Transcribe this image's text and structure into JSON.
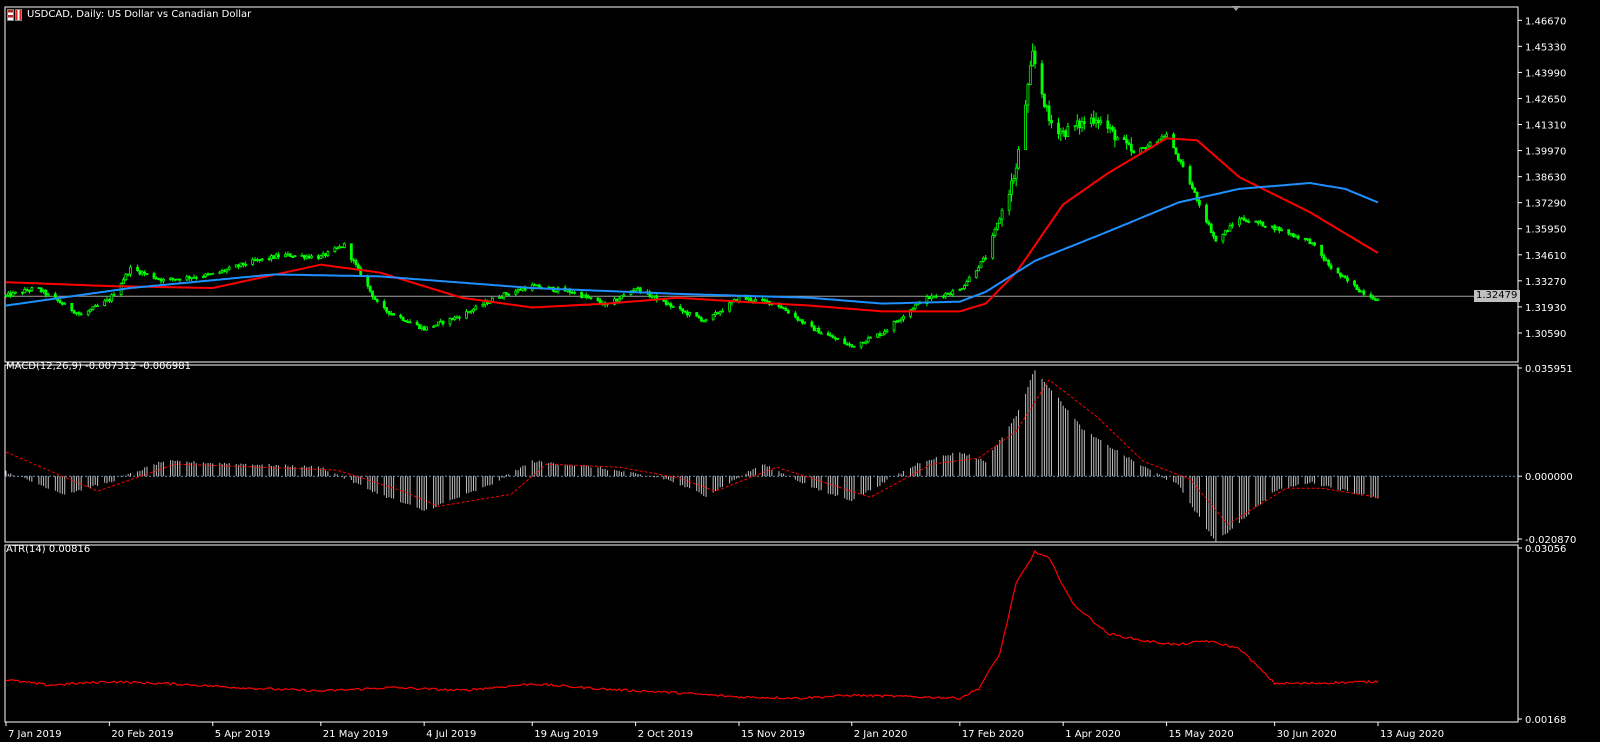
{
  "header": {
    "title": "USDCAD, Daily:  US Dollar vs Canadian Dollar"
  },
  "colors": {
    "background": "#000000",
    "axis": "#ffffff",
    "candle_up": "#00ff00",
    "ma_fast": "#ff0000",
    "ma_slow": "#1e90ff",
    "macd_hist": "#c0c0c0",
    "macd_signal": "#ff0000",
    "atr_line": "#ff0000"
  },
  "chart_data": [
    {
      "type": "candlestick",
      "name": "price",
      "ylim": [
        1.2925,
        1.472
      ],
      "y_ticks": [
        "1.46670",
        "1.45330",
        "1.43990",
        "1.42650",
        "1.41310",
        "1.39970",
        "1.38630",
        "1.37290",
        "1.35950",
        "1.34610",
        "1.33270",
        "1.31930",
        "1.30590"
      ],
      "y_tick_values": [
        1.4667,
        1.4533,
        1.4399,
        1.4265,
        1.4131,
        1.3997,
        1.3863,
        1.3729,
        1.3595,
        1.3461,
        1.3327,
        1.3193,
        1.3059
      ],
      "current_price_label": "1.32479",
      "current_price": 1.32479,
      "close_path": {
        "dates": [
          "2019-01-07",
          "2019-01-20",
          "2019-02-08",
          "2019-02-20",
          "2019-03-01",
          "2019-03-15",
          "2019-04-05",
          "2019-04-20",
          "2019-05-05",
          "2019-05-21",
          "2019-05-31",
          "2019-06-15",
          "2019-07-04",
          "2019-07-20",
          "2019-08-05",
          "2019-08-19",
          "2019-09-05",
          "2019-09-20",
          "2019-10-02",
          "2019-10-20",
          "2019-11-01",
          "2019-11-15",
          "2019-12-01",
          "2019-12-15",
          "2020-01-02",
          "2020-01-15",
          "2020-02-01",
          "2020-02-17",
          "2020-02-28",
          "2020-03-05",
          "2020-03-12",
          "2020-03-19",
          "2020-03-26",
          "2020-04-01",
          "2020-04-15",
          "2020-05-01",
          "2020-05-15",
          "2020-05-25",
          "2020-06-05",
          "2020-06-15",
          "2020-06-30",
          "2020-07-15",
          "2020-07-25",
          "2020-08-05",
          "2020-08-13"
        ],
        "values": [
          1.325,
          1.329,
          1.315,
          1.323,
          1.339,
          1.333,
          1.336,
          1.342,
          1.346,
          1.345,
          1.351,
          1.319,
          1.308,
          1.315,
          1.325,
          1.33,
          1.327,
          1.32,
          1.329,
          1.318,
          1.312,
          1.324,
          1.321,
          1.309,
          1.299,
          1.306,
          1.323,
          1.328,
          1.345,
          1.365,
          1.39,
          1.449,
          1.415,
          1.409,
          1.417,
          1.398,
          1.408,
          1.383,
          1.353,
          1.365,
          1.36,
          1.353,
          1.338,
          1.328,
          1.323
        ]
      }
    },
    {
      "type": "line",
      "name": "ma_fast",
      "x": [
        "2019-01-07",
        "2019-02-20",
        "2019-04-05",
        "2019-05-21",
        "2019-06-15",
        "2019-07-20",
        "2019-08-19",
        "2019-09-20",
        "2019-10-20",
        "2019-11-15",
        "2019-12-15",
        "2020-01-15",
        "2020-02-17",
        "2020-02-28",
        "2020-03-12",
        "2020-04-01",
        "2020-04-20",
        "2020-05-15",
        "2020-05-28",
        "2020-06-15",
        "2020-07-15",
        "2020-08-13"
      ],
      "y": [
        1.332,
        1.33,
        1.329,
        1.341,
        1.337,
        1.324,
        1.319,
        1.321,
        1.324,
        1.322,
        1.32,
        1.317,
        1.317,
        1.321,
        1.337,
        1.372,
        1.388,
        1.406,
        1.405,
        1.386,
        1.368,
        1.347
      ]
    },
    {
      "type": "line",
      "name": "ma_slow",
      "x": [
        "2019-01-07",
        "2019-03-01",
        "2019-05-01",
        "2019-06-15",
        "2019-08-19",
        "2019-10-20",
        "2019-12-15",
        "2020-01-15",
        "2020-02-17",
        "2020-02-28",
        "2020-03-20",
        "2020-04-20",
        "2020-05-20",
        "2020-06-15",
        "2020-07-15",
        "2020-07-30",
        "2020-08-13"
      ],
      "y": [
        1.32,
        1.329,
        1.336,
        1.335,
        1.329,
        1.326,
        1.324,
        1.321,
        1.322,
        1.327,
        1.343,
        1.358,
        1.373,
        1.38,
        1.383,
        1.38,
        1.373
      ]
    },
    {
      "type": "bar",
      "name": "MACD",
      "label": "MACD(12,26,9) -0.007312 -0.006981",
      "ylim": [
        -0.02087,
        0.035951
      ],
      "y_ticks": [
        "0.035951",
        "0.000000",
        "-0.020870"
      ],
      "y_tick_values": [
        0.035951,
        0.0,
        -0.02087
      ],
      "hist_path": {
        "dates": [
          "2019-01-07",
          "2019-02-01",
          "2019-02-20",
          "2019-03-15",
          "2019-04-20",
          "2019-05-21",
          "2019-06-15",
          "2019-07-04",
          "2019-08-01",
          "2019-08-19",
          "2019-09-15",
          "2019-10-15",
          "2019-11-01",
          "2019-11-25",
          "2019-12-20",
          "2020-01-02",
          "2020-02-01",
          "2020-02-17",
          "2020-02-28",
          "2020-03-12",
          "2020-03-20",
          "2020-04-10",
          "2020-05-01",
          "2020-05-20",
          "2020-06-05",
          "2020-06-30",
          "2020-07-15",
          "2020-08-13"
        ],
        "values": [
          0.0015,
          -0.006,
          -0.002,
          0.005,
          0.004,
          0.003,
          -0.006,
          -0.0115,
          -0.003,
          0.005,
          0.003,
          -0.001,
          -0.0065,
          0.004,
          -0.005,
          -0.008,
          0.005,
          0.008,
          0.005,
          0.02,
          0.0355,
          0.015,
          0.005,
          -0.003,
          -0.022,
          -0.005,
          -0.002,
          -0.0073
        ]
      },
      "signal_path": {
        "dates": [
          "2019-01-07",
          "2019-02-15",
          "2019-03-20",
          "2019-04-25",
          "2019-05-28",
          "2019-06-25",
          "2019-07-10",
          "2019-08-10",
          "2019-08-25",
          "2019-09-25",
          "2019-10-20",
          "2019-11-05",
          "2019-12-01",
          "2019-12-25",
          "2020-01-10",
          "2020-02-05",
          "2020-02-25",
          "2020-03-12",
          "2020-03-26",
          "2020-04-15",
          "2020-05-05",
          "2020-05-25",
          "2020-06-10",
          "2020-07-05",
          "2020-07-20",
          "2020-08-13"
        ],
        "values": [
          0.008,
          -0.005,
          0.004,
          0.003,
          0.002,
          -0.005,
          -0.01,
          -0.006,
          0.004,
          0.003,
          -0.0005,
          -0.005,
          0.003,
          -0.003,
          -0.007,
          0.004,
          0.006,
          0.015,
          0.032,
          0.02,
          0.005,
          -0.001,
          -0.016,
          -0.004,
          -0.004,
          -0.007
        ]
      }
    },
    {
      "type": "line",
      "name": "ATR",
      "label": "ATR(14) 0.00816",
      "ylim": [
        0.00168,
        0.03056
      ],
      "y_ticks": [
        "0.03056",
        "0.00168"
      ],
      "y_tick_values": [
        0.03056,
        0.00168
      ],
      "x": [
        "2019-01-07",
        "2019-01-25",
        "2019-02-20",
        "2019-03-20",
        "2019-04-20",
        "2019-05-21",
        "2019-06-20",
        "2019-07-20",
        "2019-08-19",
        "2019-09-20",
        "2019-10-20",
        "2019-11-15",
        "2019-12-10",
        "2020-01-02",
        "2020-02-01",
        "2020-02-17",
        "2020-02-25",
        "2020-03-05",
        "2020-03-12",
        "2020-03-20",
        "2020-03-26",
        "2020-04-05",
        "2020-04-20",
        "2020-05-05",
        "2020-05-20",
        "2020-06-01",
        "2020-06-15",
        "2020-06-30",
        "2020-07-15",
        "2020-08-13"
      ],
      "y": [
        0.0083,
        0.0074,
        0.008,
        0.0076,
        0.0069,
        0.0064,
        0.007,
        0.0065,
        0.0076,
        0.0067,
        0.0061,
        0.0054,
        0.0052,
        0.0057,
        0.0054,
        0.0052,
        0.0068,
        0.0127,
        0.0246,
        0.0299,
        0.0288,
        0.0212,
        0.0161,
        0.0149,
        0.0142,
        0.0149,
        0.0136,
        0.0077,
        0.0077,
        0.008
      ]
    }
  ],
  "x_axis": {
    "ticks": [
      "7 Jan 2019",
      "20 Feb 2019",
      "5 Apr 2019",
      "21 May 2019",
      "4 Jul 2019",
      "19 Aug 2019",
      "2 Oct 2019",
      "15 Nov 2019",
      "2 Jan 2020",
      "17 Feb 2020",
      "1 Apr 2020",
      "15 May 2020",
      "30 Jun 2020",
      "13 Aug 2020"
    ],
    "tick_dates": [
      "2019-01-07",
      "2019-02-20",
      "2019-04-05",
      "2019-05-21",
      "2019-07-04",
      "2019-08-19",
      "2019-10-02",
      "2019-11-15",
      "2020-01-02",
      "2020-02-17",
      "2020-04-01",
      "2020-05-15",
      "2020-06-30",
      "2020-08-13"
    ]
  }
}
